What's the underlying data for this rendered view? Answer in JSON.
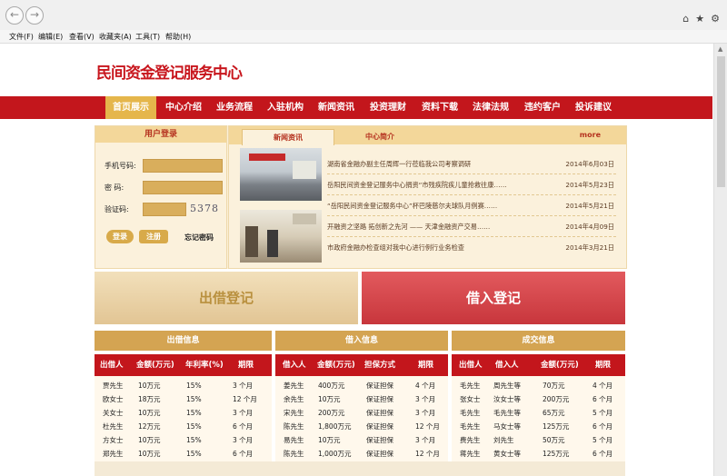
{
  "menubar": [
    "文件(F)",
    "编辑(E)",
    "查看(V)",
    "收藏夹(A)",
    "工具(T)",
    "帮助(H)"
  ],
  "site": {
    "logo": "民间资金登记服务中心"
  },
  "nav": [
    "首页展示",
    "中心介绍",
    "业务流程",
    "入驻机构",
    "新闻资讯",
    "投资理财",
    "资料下载",
    "法律法规",
    "违约客户",
    "投诉建议"
  ],
  "nav_active": 0,
  "login": {
    "title": "用户登录",
    "phone_label": "手机号码:",
    "password_label": "密  码:",
    "captcha_label": "验证码:",
    "captcha_value": "5378",
    "login_button": "登录",
    "register_button": "注册",
    "forgot": "忘记密码"
  },
  "news": {
    "tabs": [
      "新闻资讯",
      "中心简介"
    ],
    "more": "more",
    "items": [
      {
        "title": "湖南省金融办副主任周辉一行莅临我公司考察调研",
        "date": "2014年6月03日"
      },
      {
        "title": "岳阳民间资金登记服务中心捐资“市残疾院疾儿童抢救往康……",
        "date": "2014年5月23日"
      },
      {
        "title": "“岳阳民间资金登记服务中心”杯巴陵慈尔夫球队月例赛……",
        "date": "2014年5月21日"
      },
      {
        "title": "开融资之坚路  拓创新之先河  —— 天津金融资产交易……",
        "date": "2014年4月09日"
      },
      {
        "title": "市政府金融办检查组对我中心进行例行业务检查",
        "date": "2014年3月21日"
      }
    ]
  },
  "actions": {
    "lend": "出借登记",
    "borrow": "借入登记"
  },
  "lend_info": {
    "title": "出借信息",
    "headers": [
      "出借人",
      "金额(万元)",
      "年利率(%)",
      "期限"
    ],
    "rows": [
      [
        "贾先生",
        "10万元",
        "15%",
        "3 个月"
      ],
      [
        "欧女士",
        "18万元",
        "15%",
        "12 个月"
      ],
      [
        "关女士",
        "10万元",
        "15%",
        "3 个月"
      ],
      [
        "杜先生",
        "12万元",
        "15%",
        "6 个月"
      ],
      [
        "方女士",
        "10万元",
        "15%",
        "3 个月"
      ],
      [
        "郑先生",
        "10万元",
        "15%",
        "6 个月"
      ]
    ]
  },
  "borrow_info": {
    "title": "借入信息",
    "headers": [
      "借入人",
      "金额(万元)",
      "担保方式",
      "期限"
    ],
    "rows": [
      [
        "姜先生",
        "400万元",
        "保证担保",
        "4 个月"
      ],
      [
        "余先生",
        "10万元",
        "保证担保",
        "3 个月"
      ],
      [
        "宋先生",
        "200万元",
        "保证担保",
        "3 个月"
      ],
      [
        "陈先生",
        "1,800万元",
        "保证担保",
        "12 个月"
      ],
      [
        "易先生",
        "10万元",
        "保证担保",
        "3 个月"
      ],
      [
        "陈先生",
        "1,000万元",
        "保证担保",
        "12 个月"
      ]
    ]
  },
  "deal_info": {
    "title": "成交信息",
    "headers": [
      "出借人",
      "借入人",
      "金额(万元)",
      "期限"
    ],
    "rows": [
      [
        "毛先生",
        "周先生等",
        "70万元",
        "4 个月"
      ],
      [
        "张女士",
        "汝女士等",
        "200万元",
        "6 个月"
      ],
      [
        "毛先生",
        "毛先生等",
        "65万元",
        "5 个月"
      ],
      [
        "毛先生",
        "马女士等",
        "125万元",
        "6 个月"
      ],
      [
        "费先生",
        "刘先生",
        "50万元",
        "5 个月"
      ],
      [
        "蒋先生",
        "黄女士等",
        "125万元",
        "6 个月"
      ]
    ]
  },
  "colors": {
    "brand_red": "#c3161c",
    "gold": "#d4a452",
    "lend_bg": "#e9cf9f",
    "borrow_bg": "#d2444a"
  }
}
